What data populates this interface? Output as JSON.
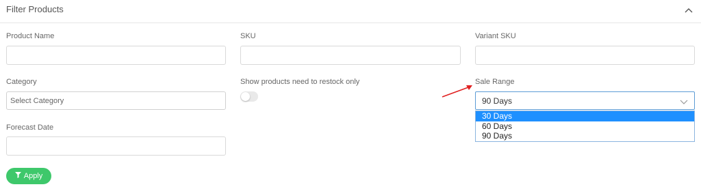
{
  "panel": {
    "title": "Filter Products"
  },
  "fields": {
    "product_name": {
      "label": "Product Name",
      "value": ""
    },
    "sku": {
      "label": "SKU",
      "value": ""
    },
    "variant_sku": {
      "label": "Variant SKU",
      "value": ""
    },
    "category": {
      "label": "Category",
      "placeholder": "Select Category"
    },
    "restock": {
      "label": "Show products need to restock only",
      "checked": false
    },
    "sale_range": {
      "label": "Sale Range",
      "selected": "90 Days",
      "options": [
        "30 Days",
        "60 Days",
        "90 Days"
      ],
      "highlighted": "30 Days"
    },
    "forecast_date": {
      "label": "Forecast Date",
      "value": ""
    }
  },
  "apply_button": {
    "label": "Apply"
  },
  "colors": {
    "accent_green": "#3ec86b",
    "highlight_blue": "#1e90ff",
    "annotation_red": "#e02020"
  }
}
